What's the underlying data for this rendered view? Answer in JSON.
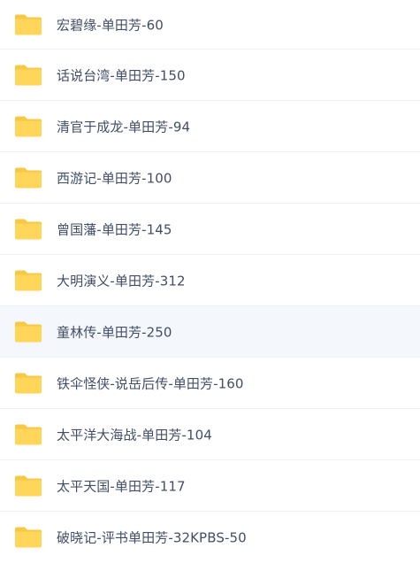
{
  "folders": [
    {
      "name": "宏碧缘-单田芳-60",
      "icon": "folder-icon",
      "selected": false
    },
    {
      "name": "话说台湾-单田芳-150",
      "icon": "folder-icon",
      "selected": false
    },
    {
      "name": "清官于成龙-单田芳-94",
      "icon": "folder-icon",
      "selected": false
    },
    {
      "name": "西游记-单田芳-100",
      "icon": "folder-icon",
      "selected": false
    },
    {
      "name": "曾国藩-单田芳-145",
      "icon": "folder-icon",
      "selected": false
    },
    {
      "name": "大明演义-单田芳-312",
      "icon": "folder-icon",
      "selected": false
    },
    {
      "name": "童林传-单田芳-250",
      "icon": "folder-icon",
      "selected": true
    },
    {
      "name": "铁伞怪侠-说岳后传-单田芳-160",
      "icon": "folder-icon",
      "selected": false
    },
    {
      "name": "太平洋大海战-单田芳-104",
      "icon": "folder-icon",
      "selected": false
    },
    {
      "name": "太平天国-单田芳-117",
      "icon": "folder-icon",
      "selected": false
    },
    {
      "name": "破晓记-评书单田芳-32KPBS-50",
      "icon": "folder-icon",
      "selected": false
    }
  ],
  "colors": {
    "folder_body": "#ffd659",
    "folder_tab": "#f7c843",
    "text": "#424e67",
    "selected_row": "#f4f7fb",
    "divider": "#eef0f4"
  }
}
